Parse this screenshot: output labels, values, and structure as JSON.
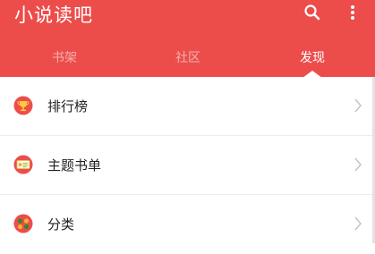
{
  "app": {
    "title": "小说读吧",
    "accent_color": "#ec4d4b"
  },
  "toolbar": {
    "search_icon": "search-icon",
    "more_icon": "more-vertical-icon"
  },
  "tabs": [
    {
      "label": "书架",
      "selected": false
    },
    {
      "label": "社区",
      "selected": false
    },
    {
      "label": "发现",
      "selected": true
    }
  ],
  "menu": {
    "items": [
      {
        "label": "排行榜",
        "icon": "trophy-icon"
      },
      {
        "label": "主题书单",
        "icon": "booklist-card-icon"
      },
      {
        "label": "分类",
        "icon": "category-dots-icon"
      }
    ],
    "chevron_icon": "chevron-right-icon"
  }
}
